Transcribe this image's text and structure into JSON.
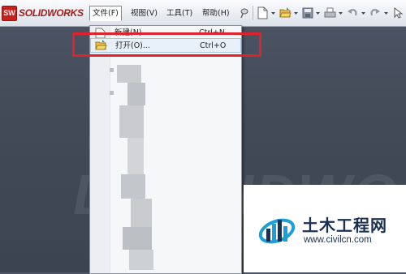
{
  "app": {
    "logo_badge": "SW",
    "logo_text": "SOLIDWORKS"
  },
  "menubar": [
    {
      "label": "文件(F)"
    },
    {
      "label": "视图(V)"
    },
    {
      "label": "工具(T)"
    },
    {
      "label": "帮助(H)"
    }
  ],
  "toolbar": {
    "icons": [
      "pin-icon",
      "new-document-icon",
      "open-folder-icon",
      "save-icon",
      "print-icon",
      "undo-icon",
      "redo-icon"
    ]
  },
  "file_menu": {
    "items": [
      {
        "label": "新建(N)...",
        "shortcut": "Ctrl+N"
      },
      {
        "label": "打开(O)...",
        "shortcut": "Ctrl+O"
      }
    ]
  },
  "watermark": {
    "title": "土木工程网",
    "url": "www.civilcn.com",
    "background_text": "DSOLIDWORKS"
  },
  "colors": {
    "highlight_box": "#e0232a",
    "logo_red": "#c8221f",
    "watermark_navy": "#1a2f52",
    "watermark_cyan": "#1a9fd8"
  }
}
